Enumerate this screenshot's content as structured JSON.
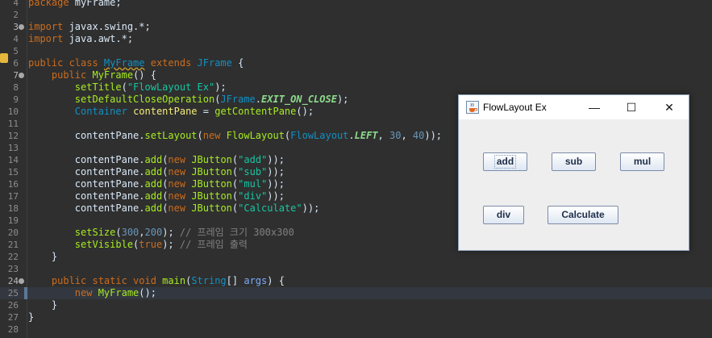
{
  "editor": {
    "lines": [
      {
        "n": "4",
        "tokens": [
          {
            "t": "package ",
            "c": "kw"
          },
          {
            "t": "myFrame;",
            "c": ""
          }
        ]
      },
      {
        "n": "2",
        "tokens": []
      },
      {
        "n": "3",
        "fold": true,
        "tokens": [
          {
            "t": "import ",
            "c": "kw"
          },
          {
            "t": "javax.swing.*;",
            "c": ""
          }
        ]
      },
      {
        "n": "4",
        "tokens": [
          {
            "t": "import ",
            "c": "kw"
          },
          {
            "t": "java.awt.*;",
            "c": ""
          }
        ]
      },
      {
        "n": "5",
        "tokens": []
      },
      {
        "n": "6",
        "tokens": [
          {
            "t": "public class ",
            "c": "kw"
          },
          {
            "t": "MyFrame",
            "c": "cls ul"
          },
          {
            "t": " extends ",
            "c": "kw"
          },
          {
            "t": "JFrame",
            "c": "cls"
          },
          {
            "t": " {",
            "c": ""
          }
        ]
      },
      {
        "n": "7",
        "fold": true,
        "tokens": [
          {
            "t": "    public ",
            "c": "kw"
          },
          {
            "t": "MyFrame",
            "c": "call"
          },
          {
            "t": "() {",
            "c": ""
          }
        ]
      },
      {
        "n": "8",
        "tokens": [
          {
            "t": "        ",
            "c": ""
          },
          {
            "t": "setTitle",
            "c": "call"
          },
          {
            "t": "(",
            "c": ""
          },
          {
            "t": "\"FlowLayout Ex\"",
            "c": "str"
          },
          {
            "t": ");",
            "c": ""
          }
        ]
      },
      {
        "n": "9",
        "tokens": [
          {
            "t": "        ",
            "c": ""
          },
          {
            "t": "setDefaultCloseOperation",
            "c": "call"
          },
          {
            "t": "(",
            "c": ""
          },
          {
            "t": "JFrame",
            "c": "cls"
          },
          {
            "t": ".",
            "c": ""
          },
          {
            "t": "EXIT_ON_CLOSE",
            "c": "fld"
          },
          {
            "t": ");",
            "c": ""
          }
        ]
      },
      {
        "n": "10",
        "tokens": [
          {
            "t": "        ",
            "c": ""
          },
          {
            "t": "Container",
            "c": "type"
          },
          {
            "t": " ",
            "c": ""
          },
          {
            "t": "contentPane",
            "c": "var"
          },
          {
            "t": " = ",
            "c": ""
          },
          {
            "t": "getContentPane",
            "c": "call"
          },
          {
            "t": "();",
            "c": ""
          }
        ]
      },
      {
        "n": "11",
        "tokens": []
      },
      {
        "n": "12",
        "tokens": [
          {
            "t": "        contentPane.",
            "c": ""
          },
          {
            "t": "setLayout",
            "c": "call"
          },
          {
            "t": "(",
            "c": ""
          },
          {
            "t": "new ",
            "c": "kw"
          },
          {
            "t": "FlowLayout",
            "c": "call"
          },
          {
            "t": "(",
            "c": ""
          },
          {
            "t": "FlowLayout",
            "c": "cls"
          },
          {
            "t": ".",
            "c": ""
          },
          {
            "t": "LEFT",
            "c": "fld"
          },
          {
            "t": ", ",
            "c": ""
          },
          {
            "t": "30",
            "c": "num"
          },
          {
            "t": ", ",
            "c": ""
          },
          {
            "t": "40",
            "c": "num"
          },
          {
            "t": "));",
            "c": ""
          }
        ]
      },
      {
        "n": "13",
        "tokens": []
      },
      {
        "n": "14",
        "tokens": [
          {
            "t": "        contentPane.",
            "c": ""
          },
          {
            "t": "add",
            "c": "call"
          },
          {
            "t": "(",
            "c": ""
          },
          {
            "t": "new ",
            "c": "kw"
          },
          {
            "t": "JButton",
            "c": "call"
          },
          {
            "t": "(",
            "c": ""
          },
          {
            "t": "\"add\"",
            "c": "str"
          },
          {
            "t": "));",
            "c": ""
          }
        ]
      },
      {
        "n": "15",
        "tokens": [
          {
            "t": "        contentPane.",
            "c": ""
          },
          {
            "t": "add",
            "c": "call"
          },
          {
            "t": "(",
            "c": ""
          },
          {
            "t": "new ",
            "c": "kw"
          },
          {
            "t": "JButton",
            "c": "call"
          },
          {
            "t": "(",
            "c": ""
          },
          {
            "t": "\"sub\"",
            "c": "str"
          },
          {
            "t": "));",
            "c": ""
          }
        ]
      },
      {
        "n": "16",
        "tokens": [
          {
            "t": "        contentPane.",
            "c": ""
          },
          {
            "t": "add",
            "c": "call"
          },
          {
            "t": "(",
            "c": ""
          },
          {
            "t": "new ",
            "c": "kw"
          },
          {
            "t": "JButton",
            "c": "call"
          },
          {
            "t": "(",
            "c": ""
          },
          {
            "t": "\"mul\"",
            "c": "str"
          },
          {
            "t": "));",
            "c": ""
          }
        ]
      },
      {
        "n": "17",
        "tokens": [
          {
            "t": "        contentPane.",
            "c": ""
          },
          {
            "t": "add",
            "c": "call"
          },
          {
            "t": "(",
            "c": ""
          },
          {
            "t": "new ",
            "c": "kw"
          },
          {
            "t": "JButton",
            "c": "call"
          },
          {
            "t": "(",
            "c": ""
          },
          {
            "t": "\"div\"",
            "c": "str"
          },
          {
            "t": "));",
            "c": ""
          }
        ]
      },
      {
        "n": "18",
        "tokens": [
          {
            "t": "        contentPane.",
            "c": ""
          },
          {
            "t": "add",
            "c": "call"
          },
          {
            "t": "(",
            "c": ""
          },
          {
            "t": "new ",
            "c": "kw"
          },
          {
            "t": "JButton",
            "c": "call"
          },
          {
            "t": "(",
            "c": ""
          },
          {
            "t": "\"Calculate\"",
            "c": "str"
          },
          {
            "t": "));",
            "c": ""
          }
        ]
      },
      {
        "n": "19",
        "tokens": []
      },
      {
        "n": "20",
        "tokens": [
          {
            "t": "        ",
            "c": ""
          },
          {
            "t": "setSize",
            "c": "call"
          },
          {
            "t": "(",
            "c": ""
          },
          {
            "t": "300",
            "c": "num"
          },
          {
            "t": ",",
            "c": ""
          },
          {
            "t": "200",
            "c": "num"
          },
          {
            "t": "); ",
            "c": ""
          },
          {
            "t": "// 프레임 크기 300x300",
            "c": "cmt"
          }
        ]
      },
      {
        "n": "21",
        "tokens": [
          {
            "t": "        ",
            "c": ""
          },
          {
            "t": "setVisible",
            "c": "call"
          },
          {
            "t": "(",
            "c": ""
          },
          {
            "t": "true",
            "c": "kw"
          },
          {
            "t": "); ",
            "c": ""
          },
          {
            "t": "// 프레임 출력",
            "c": "cmt"
          }
        ]
      },
      {
        "n": "22",
        "tokens": [
          {
            "t": "    }",
            "c": ""
          }
        ]
      },
      {
        "n": "23",
        "tokens": []
      },
      {
        "n": "24",
        "fold": true,
        "tokens": [
          {
            "t": "    public static void ",
            "c": "kw"
          },
          {
            "t": "main",
            "c": "call"
          },
          {
            "t": "(",
            "c": ""
          },
          {
            "t": "String",
            "c": "type"
          },
          {
            "t": "[] ",
            "c": ""
          },
          {
            "t": "args",
            "c": "par"
          },
          {
            "t": ") {",
            "c": ""
          }
        ]
      },
      {
        "n": "25",
        "current": true,
        "tokens": [
          {
            "t": "        ",
            "c": ""
          },
          {
            "t": "new ",
            "c": "kw"
          },
          {
            "t": "MyFrame",
            "c": "call"
          },
          {
            "t": "();",
            "c": ""
          }
        ]
      },
      {
        "n": "26",
        "tokens": [
          {
            "t": "    }",
            "c": ""
          }
        ]
      },
      {
        "n": "27",
        "tokens": [
          {
            "t": "}",
            "c": ""
          }
        ]
      },
      {
        "n": "28",
        "tokens": []
      }
    ]
  },
  "window": {
    "title": "FlowLayout Ex",
    "minimize_glyph": "—",
    "maximize_glyph": "☐",
    "close_glyph": "✕",
    "buttons": {
      "add": "add",
      "sub": "sub",
      "mul": "mul",
      "div": "div",
      "calculate": "Calculate"
    }
  }
}
